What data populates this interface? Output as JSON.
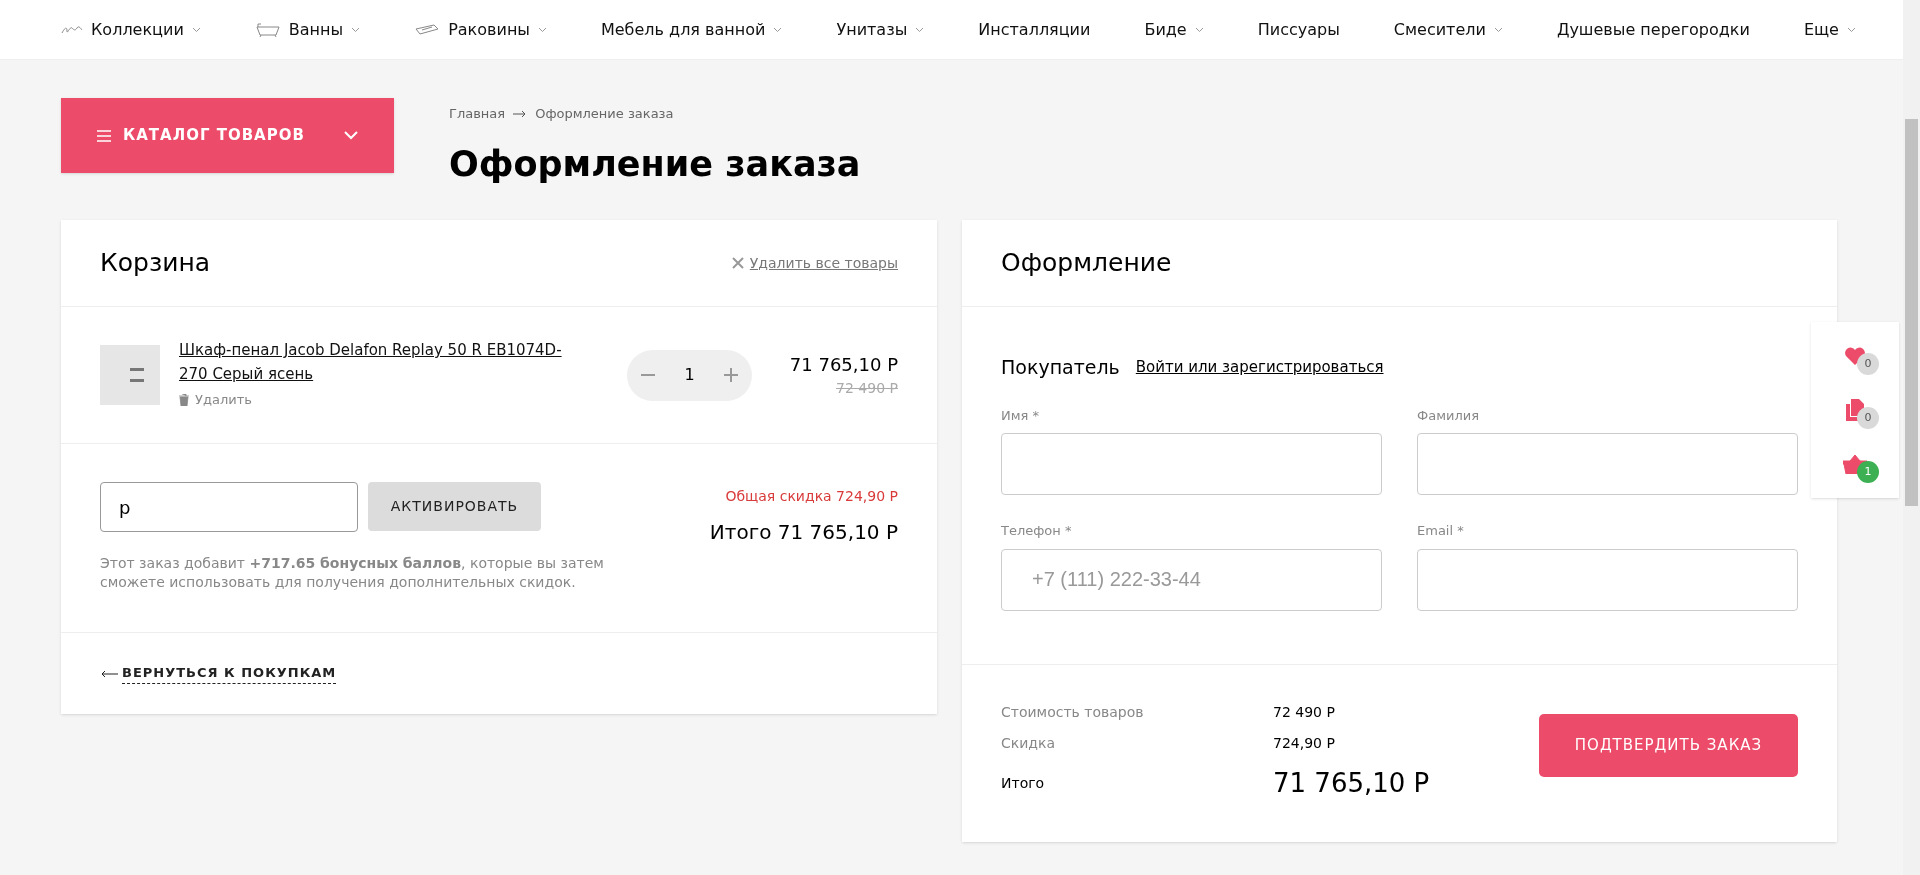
{
  "nav": [
    {
      "label": "Коллекции",
      "kind": "collection",
      "dropdown": true
    },
    {
      "label": "Ванны",
      "kind": "bath",
      "dropdown": true
    },
    {
      "label": "Раковины",
      "kind": "sink",
      "dropdown": true
    },
    {
      "label": "Мебель для ванной",
      "kind": "plain",
      "dropdown": true
    },
    {
      "label": "Унитазы",
      "kind": "plain",
      "dropdown": true
    },
    {
      "label": "Инсталляции",
      "kind": "plain",
      "dropdown": false
    },
    {
      "label": "Биде",
      "kind": "plain",
      "dropdown": true
    },
    {
      "label": "Писсуары",
      "kind": "plain",
      "dropdown": false
    },
    {
      "label": "Смесители",
      "kind": "plain",
      "dropdown": true
    },
    {
      "label": "Душевые перегородки",
      "kind": "plain",
      "dropdown": false
    },
    {
      "label": "Еще",
      "kind": "plain",
      "dropdown": true
    }
  ],
  "catalog_button": "КАТАЛОГ ТОВАРОВ",
  "breadcrumbs": [
    "Главная",
    "Оформление заказа"
  ],
  "page_title": "Оформление заказа",
  "cart": {
    "title": "Корзина",
    "clear_all": "Удалить все товары",
    "items": [
      {
        "name": "Шкаф-пенал Jacob Delafon Replay 50 R EB1074D-270 Серый ясень",
        "remove": "Удалить",
        "quantity": "1",
        "price": "71 765,10 Р",
        "old_price": "72 490 Р"
      }
    ],
    "coupon": {
      "value": "р",
      "button": "АКТИВИРОВАТЬ"
    },
    "discount": "Общая скидка 724,90 Р",
    "total": "Итого 71 765,10 Р",
    "bonus_note": "Этот заказ добавит **+717.65 бонусных баллов**, которые вы затем сможете использовать для получения дополнительных скидок.",
    "back_link": "ВЕРНУТЬСЯ К ПОКУПКАМ"
  },
  "checkout": {
    "title": "Оформление",
    "buyer_label": "Покупатель",
    "login_link": "Войти или зарегистрироваться",
    "fields": [
      {
        "label": "Имя *"
      },
      {
        "label": "Фамилия"
      },
      {
        "label": "Телефон *",
        "placeholder": "+7 (111) 222-33-44"
      },
      {
        "label": "Email *"
      }
    ],
    "summary": [
      {
        "label": "Стоимость товаров",
        "value": "72 490 Р"
      },
      {
        "label": "Скидка",
        "value": "724,90 Р"
      }
    ],
    "total_label": "Итого",
    "total_value": "71 765,10 Р",
    "confirm_button": "ПОДТВЕРДИТЬ ЗАКАЗ"
  },
  "side_widget": [
    {
      "kind": "heart",
      "count": "0",
      "color": "#d9d9d9"
    },
    {
      "kind": "compare",
      "count": "0",
      "color": "#d9d9d9"
    },
    {
      "kind": "basket",
      "count": "1",
      "color": "#3db053"
    }
  ]
}
